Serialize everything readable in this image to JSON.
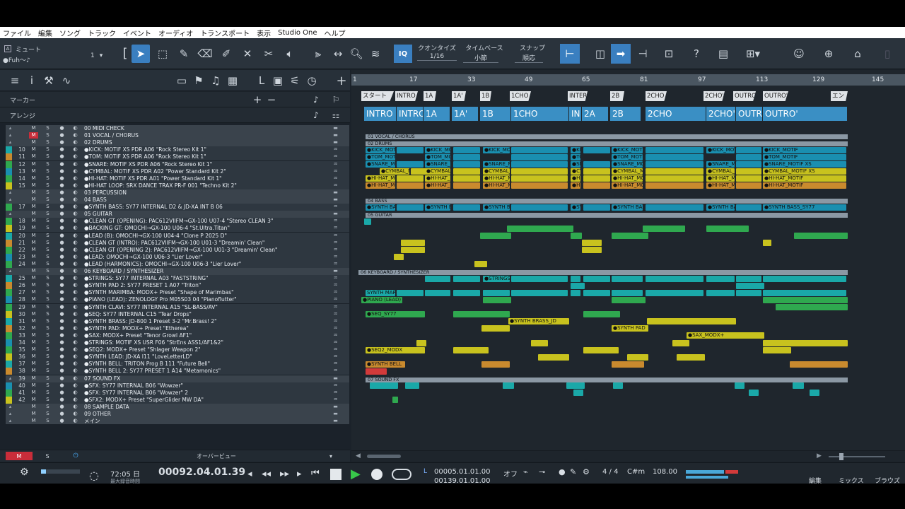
{
  "menu": [
    "ファイル",
    "編集",
    "ソング",
    "トラック",
    "イベント",
    "オーディオ",
    "トランスポート",
    "表示",
    "Studio One",
    "ヘルプ"
  ],
  "toolbar": {
    "mute_label": "ミュート",
    "track_name": "●Fuh～♪",
    "track_number": "1",
    "iq": "IQ",
    "quantize_label": "クオンタイズ",
    "quantize_value": "1/16",
    "timebase_label": "タイムベース",
    "timebase_value": "小節",
    "snap_label": "スナップ",
    "snap_value": "順応"
  },
  "panel": {
    "marker_label": "マーカー",
    "arrange_label": "アレンジ",
    "overview_label": "オーバービュー"
  },
  "ruler": [
    "1",
    "17",
    "33",
    "49",
    "65",
    "81",
    "97",
    "113",
    "129",
    "145"
  ],
  "markers": [
    "スタート",
    "INTRO",
    "1A",
    "1A'",
    "1B",
    "1CHO",
    "INTER",
    "2B",
    "2CHO",
    "2CHO'",
    "OUTRO",
    "OUTRO'",
    "エンド"
  ],
  "arrange": [
    "INTRO",
    "INTRO'",
    "1A",
    "1A'",
    "1B",
    "1CHO",
    "IN",
    "2A",
    "2B",
    "2CHO",
    "2CHO'",
    "OUTRO",
    "OUTRO'"
  ],
  "tracks": [
    {
      "num": "",
      "name": "00 MIDI CHECK",
      "folder": true
    },
    {
      "num": "",
      "name": "01 VOCAL / CHORUS",
      "folder": true
    },
    {
      "num": "",
      "name": "02 DRUMS",
      "folder": true
    },
    {
      "num": "10",
      "name": "●KICK: MOTIF XS PDR A06 \"Rock Stereo Kit 1\""
    },
    {
      "num": "11",
      "name": "●TOM: MOTIF XS PDR A06 \"Rock Stereo Kit 1\""
    },
    {
      "num": "12",
      "name": "●SNARE: MOTIF XS PDR A06 \"Rock Stereo Kit 1\""
    },
    {
      "num": "13",
      "name": "●CYMBAL: MOTIF XS PDR A02 \"Power Standard Kit 2\""
    },
    {
      "num": "14",
      "name": "●HI-HAT: MOTIF XS PDR A01 \"Power Standard Kit 1\""
    },
    {
      "num": "15",
      "name": "●HI-HAT LOOP: SRX DANCE TRAX PR-F 001 \"Techno Kit 2\""
    },
    {
      "num": "",
      "name": "03 PERCUSSION",
      "folder": true
    },
    {
      "num": "",
      "name": "04 BASS",
      "folder": true
    },
    {
      "num": "17",
      "name": "●SYNTH BASS: SY77 INTERNAL D2 & JD-XA INT B 06"
    },
    {
      "num": "",
      "name": "05 GUITAR",
      "folder": true
    },
    {
      "num": "18",
      "name": "●CLEAN GT (OPENING): PAC612VIIFM→GX-100 U07-4 \"Stereo CLEAN 3\""
    },
    {
      "num": "19",
      "name": "●BACKING GT: OMOCHI→GX-100 U06-4 \"St.Ultra.Titan\""
    },
    {
      "num": "20",
      "name": "●LEAD (B): OMOCHI→GX-100 U04-4 \"Clone P 2025 D\""
    },
    {
      "num": "21",
      "name": "●CLEAN GT (INTRO): PAC612VIIFM→GX-100 U01-3 \"Dreamin' Clean\""
    },
    {
      "num": "22",
      "name": "●CLEAN GT (OPENING 2): PAC612VIIFM→GX-100 U01-3 \"Dreamin' Clean\""
    },
    {
      "num": "23",
      "name": "●LEAD: OMOCHI→GX-100 U06-3 \"Lier Lover\""
    },
    {
      "num": "24",
      "name": "●LEAD (HARMONICS): OMOCHI→GX-100 U06-3 \"Lier Lover\""
    },
    {
      "num": "",
      "name": "06 KEYBOARD / SYNTHESIZER",
      "folder": true
    },
    {
      "num": "25",
      "name": "●STRINGS: SY77 INTERNAL A03 \"FASTSTRING\""
    },
    {
      "num": "26",
      "name": "●SYNTH PAD 2: SY77 PRESET 1 A07 \"Triton\""
    },
    {
      "num": "27",
      "name": "●SYNTH MARIMBA: MODX+ Preset \"Shape of Marimbas\""
    },
    {
      "num": "28",
      "name": "●PIANO (LEAD): ZENOLOGY Pro M05S03 04 \"Pianoflutter\""
    },
    {
      "num": "29",
      "name": "●SYNTH CLAVI: SY77 INTERNAL A15 \"SL-BASS/AV\""
    },
    {
      "num": "30",
      "name": "●SEQ: SY77 INTERNAL C15 \"Tear Drops\""
    },
    {
      "num": "31",
      "name": "●SYNTH BRASS: JD-800 1 Preset 3-2 \"Mr.Brass! 2\""
    },
    {
      "num": "32",
      "name": "●SYNTH PAD: MODX+ Preset \"Etherea\""
    },
    {
      "num": "33",
      "name": "●SAX: MODX+ Preset \"Tenor Growl AF1\""
    },
    {
      "num": "34",
      "name": "●STRINGS: MOTIF XS USR F06 \"StrEns ASS1/AF1&2\""
    },
    {
      "num": "35",
      "name": "●SEQ2: MODX+ Preset \"Shlager Weapon 2\""
    },
    {
      "num": "36",
      "name": "●SYNTH LEAD: JD-XA I11 \"LoveLetterLD\""
    },
    {
      "num": "37",
      "name": "●SYNTH BELL: TRITON Prog B 111 \"Future Bell\""
    },
    {
      "num": "38",
      "name": "●SYNTH BELL 2: SY77 PRESET 1 A14 \"Metamonics\""
    },
    {
      "num": "39",
      "name": "07 SOUND FX",
      "folder": true
    },
    {
      "num": "40",
      "name": "●SFX: SY77 INTERNAL B06 \"Wowzer\""
    },
    {
      "num": "41",
      "name": "●SFX: SY77 INTERNAL B06 \"Wowzer\" 2"
    },
    {
      "num": "42",
      "name": "●SFX2: MODX+ Preset \"SuperGlider MW DA\""
    },
    {
      "num": "",
      "name": "08 SAMPLE DATA",
      "folder": true
    },
    {
      "num": "",
      "name": "09 OTHER",
      "folder": true
    },
    {
      "num": "",
      "name": "メイン",
      "folder": true
    }
  ],
  "clip_labels": {
    "vocal": "01 VOCAL / CHORUS",
    "drums": "02 DRUMS",
    "kick": "●KICK_MOTIF",
    "tom": "●TOM_MOTIF",
    "snare": "●SNARE_MOTIF XS",
    "cymbal": "●CYMBAL_MOTIF XS",
    "hihat": "●HI-HAT_MOTIF",
    "bass": "04 BASS",
    "synthbass": "●SYNTH BASS_SY77",
    "guitar": "05 GUITAR",
    "keys": "06 KEYBOARD / SYNTHESIZER",
    "strings": "●STRINGS_SY77 INTE",
    "marimba": "SYNTH MARIMBA_MODX",
    "piano": "●PIANO (LEAD)",
    "seq": "●SEQ_SY77",
    "brass": "●SYNTH BRASS_JD",
    "pad": "●SYNTH PAD",
    "sax": "●SAX_MODX+",
    "seq2": "●SEQ2_MODX",
    "bell": "●SYNTH BELL",
    "sfx": "07 SOUND FX"
  },
  "transport": {
    "time": "72:05 日",
    "time_sub": "最大録音時間",
    "position": "00092.04.01.39",
    "loop_start": "00005.01.01.00",
    "loop_end": "00139.01.01.00",
    "off": "オフ",
    "signature": "4 / 4",
    "key": "C#m",
    "tempo": "108.00",
    "edit": "編集",
    "mix": "ミックス",
    "browse": "ブラウズ"
  },
  "colors": {
    "accent": "#2e7fc0",
    "drum": "#1a8fb0",
    "green": "#2fa84f",
    "yellow": "#c8c21e",
    "teal": "#1aa8a8",
    "orange": "#c98a2e",
    "red": "#d23a3a"
  }
}
